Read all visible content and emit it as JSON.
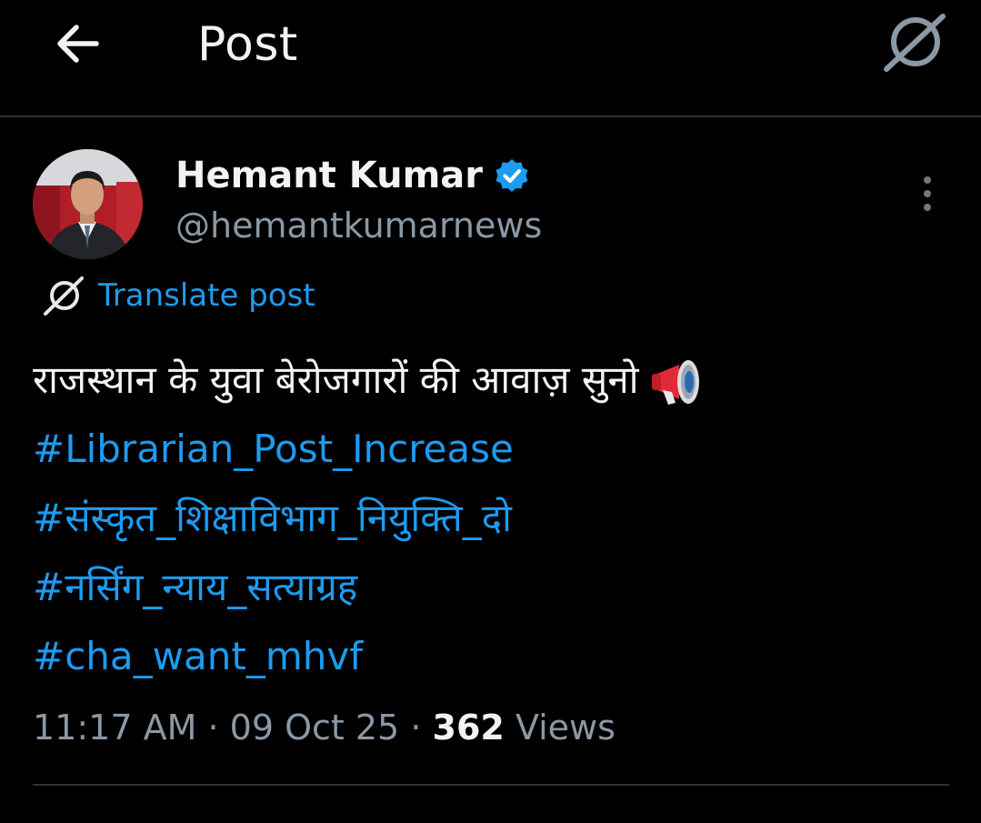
{
  "header": {
    "title": "Post",
    "back_icon": "arrow-left-icon",
    "grok_icon": "grok-icon"
  },
  "post": {
    "author": {
      "name": "Hemant Kumar",
      "handle": "@hemantkumarnews",
      "verified": true
    },
    "translate_label": "Translate post",
    "text": "राजस्थान के युवा बेरोजगारों की आवाज़ सुनो",
    "emoji": "megaphone",
    "hashtags": [
      "#Librarian_Post_Increase",
      "#संस्कृत_शिक्षाविभाग_नियुक्ति_दो",
      "#नर्सिंग_न्याय_सत्याग्रह",
      "#cha_want_mhvf"
    ],
    "time": "11:17 AM",
    "separator": "·",
    "date": "09 Oct 25",
    "views_count": "362",
    "views_label": "Views"
  },
  "colors": {
    "background": "#000000",
    "accent": "#1d9bf0",
    "muted": "#8b98a5",
    "divider": "#2f3336"
  }
}
